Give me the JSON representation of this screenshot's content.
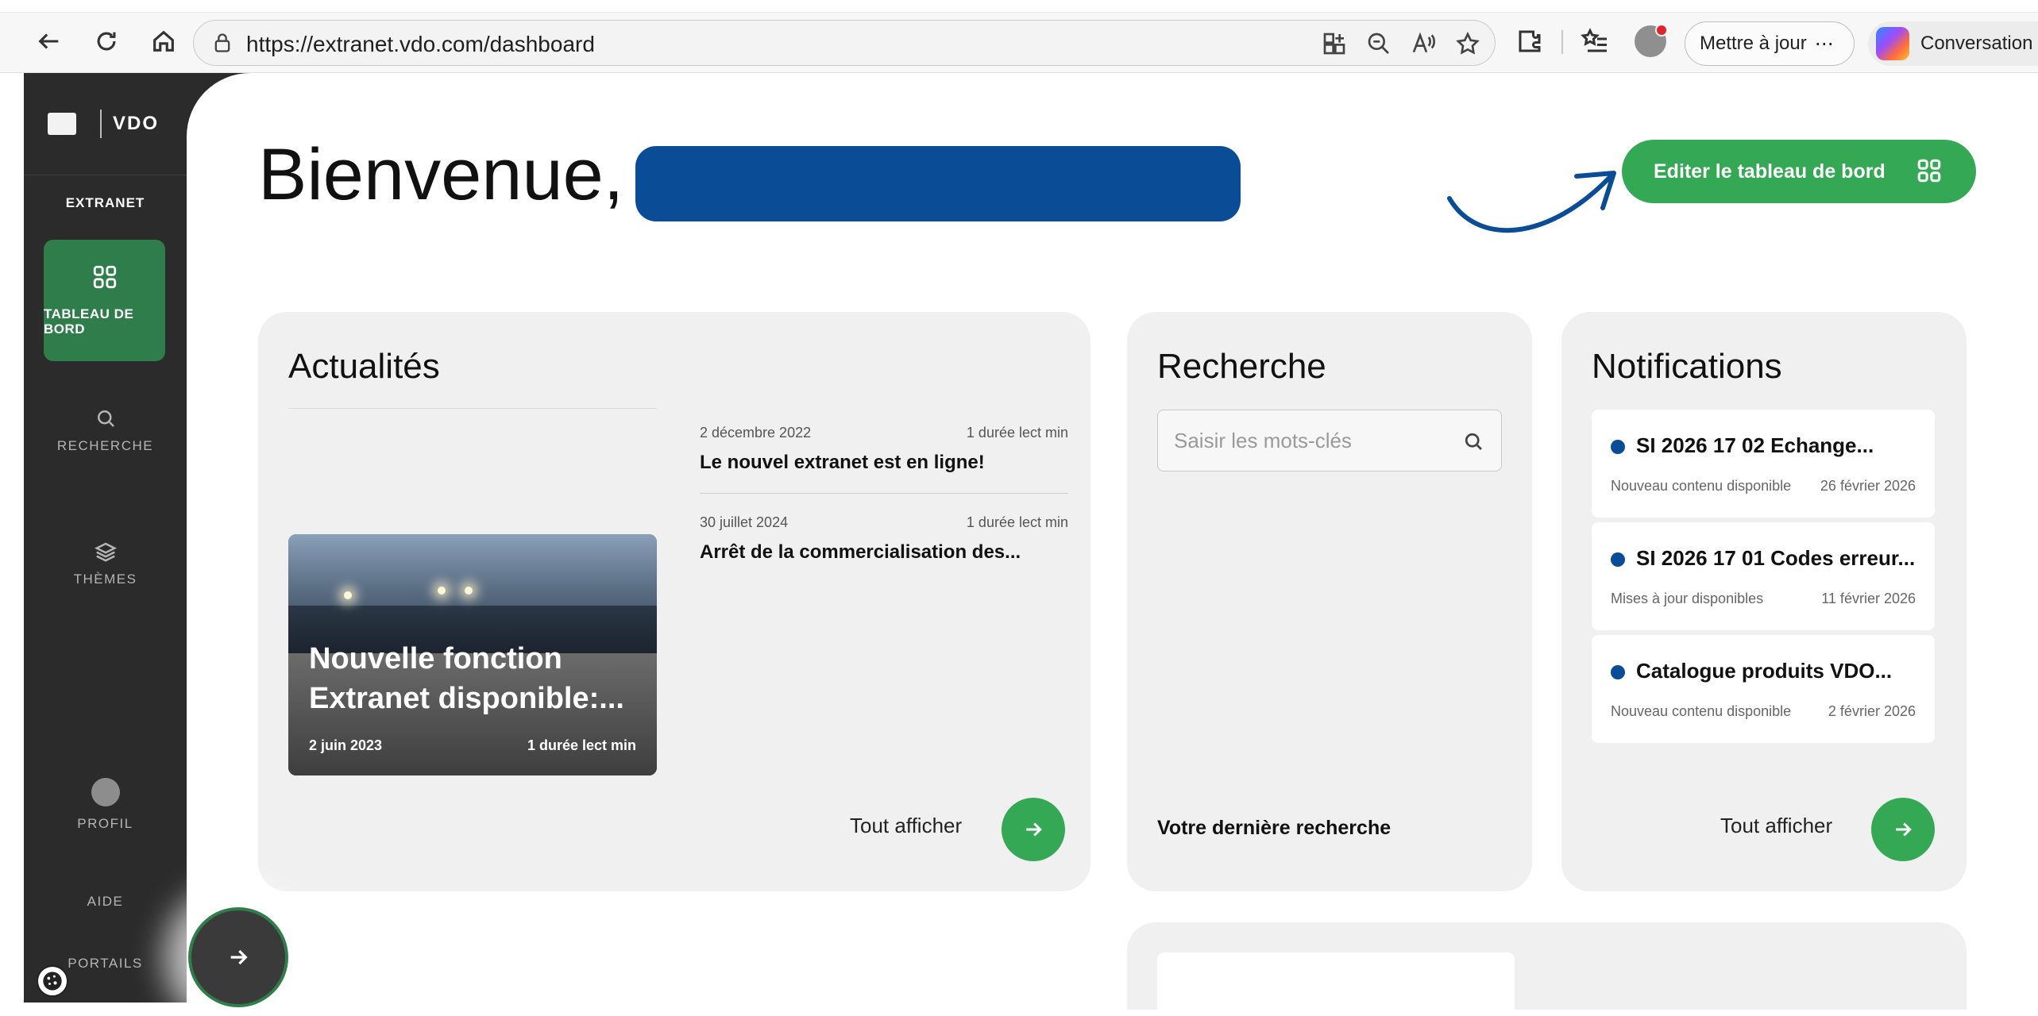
{
  "browser": {
    "url": "https://extranet.vdo.com/dashboard",
    "update_label": "Mettre à jour",
    "update_more": "⋯",
    "conversation_label": "Conversation"
  },
  "sidebar": {
    "logo_text": "VDO",
    "section_label": "EXTRANET",
    "items": [
      {
        "label": "TABLEAU DE BORD",
        "icon": "dashboard-icon",
        "active": true
      },
      {
        "label": "RECHERCHE",
        "icon": "search-icon"
      },
      {
        "label": "THÈMES",
        "icon": "layers-icon"
      },
      {
        "label": "PROFIL",
        "icon": "profile-icon"
      },
      {
        "label": "AIDE",
        "icon": ""
      },
      {
        "label": "PORTAILS",
        "icon": ""
      }
    ]
  },
  "header": {
    "title": "Bienvenue,",
    "edit_button": "Editer le tableau de bord"
  },
  "news": {
    "title": "Actualités",
    "items": [
      {
        "date": "2 décembre 2022",
        "read": "1 durée lect min",
        "headline": "Le nouvel extranet est en ligne!"
      },
      {
        "date": "30 juillet 2024",
        "read": "1 durée lect min",
        "headline": "Arrêt de la commercialisation des..."
      }
    ],
    "feature": {
      "title": "Nouvelle fonction Extranet disponible:...",
      "date": "2 juin 2023",
      "read": "1 durée lect min"
    },
    "see_all": "Tout afficher"
  },
  "search": {
    "title": "Recherche",
    "placeholder": "Saisir les mots-clés",
    "last_search": "Votre dernière recherche"
  },
  "notifications": {
    "title": "Notifications",
    "items": [
      {
        "title": "SI 2026 17 02 Echange...",
        "status": "Nouveau contenu disponible",
        "date": "26 février 2026"
      },
      {
        "title": "SI 2026 17 01 Codes erreur...",
        "status": "Mises à jour disponibles",
        "date": "11 février 2026"
      },
      {
        "title": "Catalogue produits VDO...",
        "status": "Nouveau contenu disponible",
        "date": "2 février 2026"
      }
    ],
    "see_all": "Tout afficher"
  },
  "colors": {
    "accent_green": "#35a855",
    "active_green": "#2f7d4a",
    "sidebar_bg": "#2b2b2b",
    "card_bg": "#f0f0f0",
    "redaction_blue": "#0a4d96"
  }
}
